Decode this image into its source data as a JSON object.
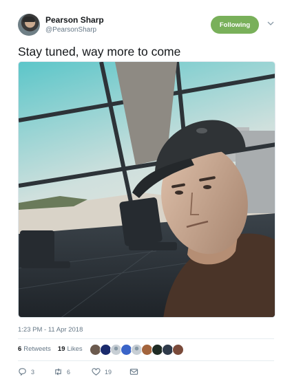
{
  "author": {
    "display_name": "Pearson Sharp",
    "handle": "@PearsonSharp"
  },
  "follow_button": {
    "label": "Following",
    "color": "#79b05a"
  },
  "tweet": {
    "text": "Stay tuned, way more to come",
    "timestamp": "1:23 PM - 11 Apr 2018"
  },
  "stats": {
    "retweets_count": "6",
    "retweets_label": "Retweets",
    "likes_count": "19",
    "likes_label": "Likes"
  },
  "likers": [
    {
      "icon": "avatar-1",
      "color": "#6b5a4e"
    },
    {
      "icon": "avatar-2",
      "color": "#1a2a6c"
    },
    {
      "icon": "avatar-default",
      "color": "#c7ced4"
    },
    {
      "icon": "avatar-4",
      "color": "#3a64c8"
    },
    {
      "icon": "avatar-default",
      "color": "#c7ced4"
    },
    {
      "icon": "avatar-6",
      "color": "#a3643c"
    },
    {
      "icon": "avatar-7",
      "color": "#1f2b24"
    },
    {
      "icon": "avatar-8",
      "color": "#2f3a4a"
    },
    {
      "icon": "avatar-9",
      "color": "#7a4a3a"
    }
  ],
  "actions": {
    "replies": "3",
    "retweets": "6",
    "likes": "19"
  },
  "colors": {
    "text_primary": "#14171a",
    "text_secondary": "#657786",
    "divider": "#e6ecf0"
  }
}
